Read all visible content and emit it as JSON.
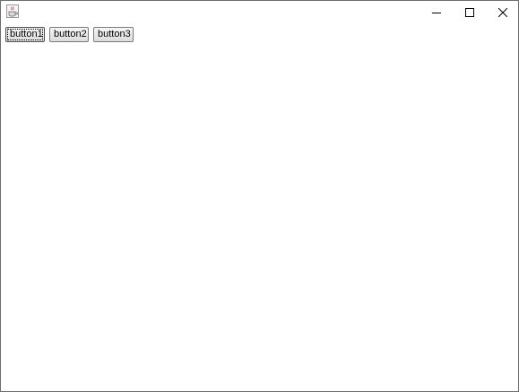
{
  "window": {
    "app_icon": "java-cup-icon",
    "controls": {
      "minimize_icon": "minimize-icon",
      "maximize_icon": "maximize-icon",
      "close_icon": "close-icon"
    }
  },
  "buttons": [
    {
      "label": "button1",
      "focused": true
    },
    {
      "label": "button2",
      "focused": false
    },
    {
      "label": "button3",
      "focused": false
    }
  ]
}
